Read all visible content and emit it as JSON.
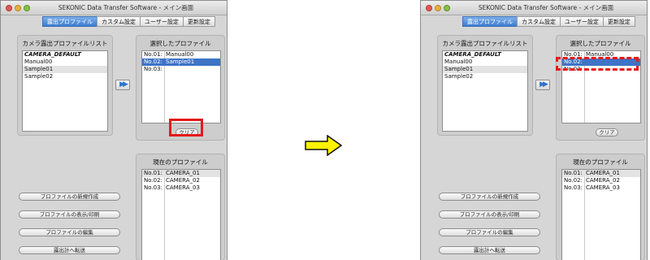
{
  "app": {
    "title": "SEKONIC Data Transfer Software - メイン画面",
    "tabs": [
      "露出プロファイル",
      "カスタム設定",
      "ユーザー設定",
      "更新設定"
    ]
  },
  "before": {
    "camera_list": {
      "title": "カメラ露出プロファイルリスト",
      "items": [
        "CAMERA_DEFAULT",
        "Manual00",
        "Sample01",
        "Sample02"
      ]
    },
    "transfer_button": "▶▶",
    "selected": {
      "title": "選択したプロファイル",
      "rows": [
        {
          "num": "No.01:",
          "name": "Manual00"
        },
        {
          "num": "No.02:",
          "name": "Sample01"
        },
        {
          "num": "No.03:",
          "name": ""
        }
      ],
      "clear_button": "クリア"
    },
    "current": {
      "title": "現在のプロファイル",
      "rows": [
        {
          "num": "No.01:",
          "name": "CAMERA_01"
        },
        {
          "num": "No.02:",
          "name": "CAMERA_02"
        },
        {
          "num": "No.03:",
          "name": "CAMERA_03"
        }
      ]
    },
    "actions": [
      "プロファイルの新規作成",
      "プロファイルの表示/印刷",
      "プロファイルの編集",
      "露出計へ転送"
    ]
  },
  "after": {
    "camera_list": {
      "title": "カメラ露出プロファイルリスト",
      "items": [
        "CAMERA_DEFAULT",
        "Manual00",
        "Sample01",
        "Sample02"
      ]
    },
    "transfer_button": "▶▶",
    "selected": {
      "title": "選択したプロファイル",
      "rows": [
        {
          "num": "No.01:",
          "name": "Manual00"
        },
        {
          "num": "No.02:",
          "name": ""
        },
        {
          "num": "No.03:",
          "name": ""
        }
      ],
      "clear_button": "クリア"
    },
    "current": {
      "title": "現在のプロファイル",
      "rows": [
        {
          "num": "No.01:",
          "name": "CAMERA_01"
        },
        {
          "num": "No.02:",
          "name": "CAMERA_02"
        },
        {
          "num": "No.03:",
          "name": "CAMERA_03"
        }
      ]
    },
    "actions": [
      "プロファイルの新規作成",
      "プロファイルの表示/印刷",
      "プロファイルの編集",
      "露出計へ転送"
    ]
  },
  "arrow_icon": "right-arrow-icon",
  "colors": {
    "highlight_red": "#e61919",
    "selection_blue": "#3e73c7",
    "arrow_fill": "#fff200"
  }
}
